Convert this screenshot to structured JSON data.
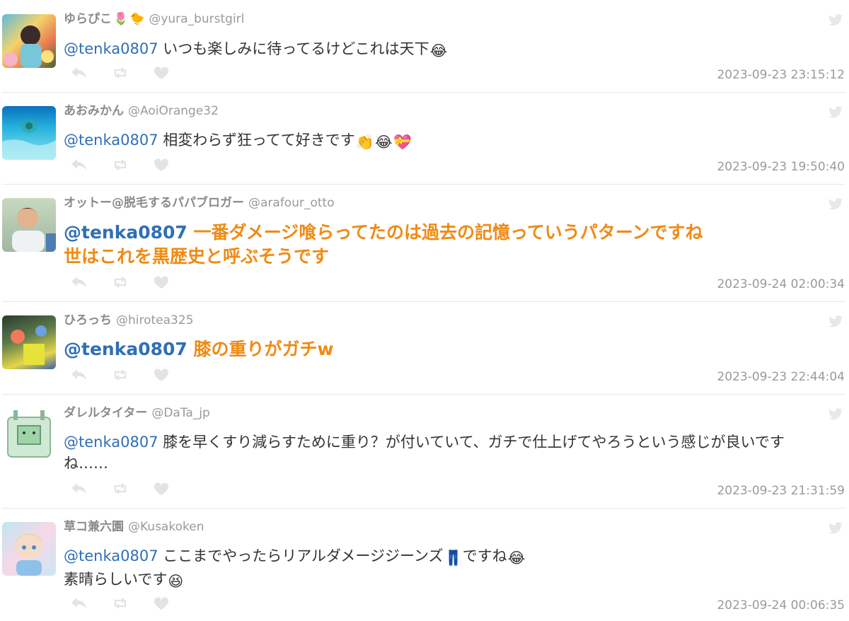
{
  "tweets": [
    {
      "name": "ゆらぴこ",
      "handle": "@yura_burstgirl",
      "mention": "@tenka0807",
      "line1": " いつも楽しみに待ってるけどこれは天下",
      "date": "2023-09-23 23:15:12"
    },
    {
      "name": "あおみかん",
      "handle": "@AoiOrange32",
      "mention": "@tenka0807",
      "line1": " 相変わらず狂ってて好きです",
      "date": "2023-09-23 19:50:40"
    },
    {
      "name": "オットー@脱毛するパパブロガー",
      "handle": "@arafour_otto",
      "mention": "@tenka0807",
      "line1": " 一番ダメージ喰らってたのは過去の記憶っていうパターンですね",
      "line2": "世はこれを黒歴史と呼ぶそうです",
      "date": "2023-09-24 02:00:34"
    },
    {
      "name": "ひろっち",
      "handle": "@hirotea325",
      "mention": "@tenka0807",
      "line1": " 膝の重りがガチw",
      "date": "2023-09-23 22:44:04"
    },
    {
      "name": "ダレルタイター",
      "handle": "@DaTa_jp",
      "mention": "@tenka0807",
      "line1": " 膝を早くすり減らすために重り？が付いていて、ガチで仕上げてやろうという感じが良いです",
      "line2": "ね……",
      "date": "2023-09-23 21:31:59"
    },
    {
      "name": "草コ兼六園",
      "handle": "@Kusakoken",
      "mention": "@tenka0807",
      "line1": " ここまでやったらリアルダメージジーンズ",
      "line1_tail": "ですね",
      "line2": "素晴らしいです",
      "date": "2023-09-24 00:06:35"
    }
  ],
  "icons": [
    "reply-icon",
    "retweet-icon",
    "like-icon",
    "twitter-bird-icon"
  ],
  "colors": {
    "mention": "#2f6fb5",
    "highlight": "#f08a14",
    "meta": "#9a9a9a",
    "icon": "#e3e3e3"
  }
}
